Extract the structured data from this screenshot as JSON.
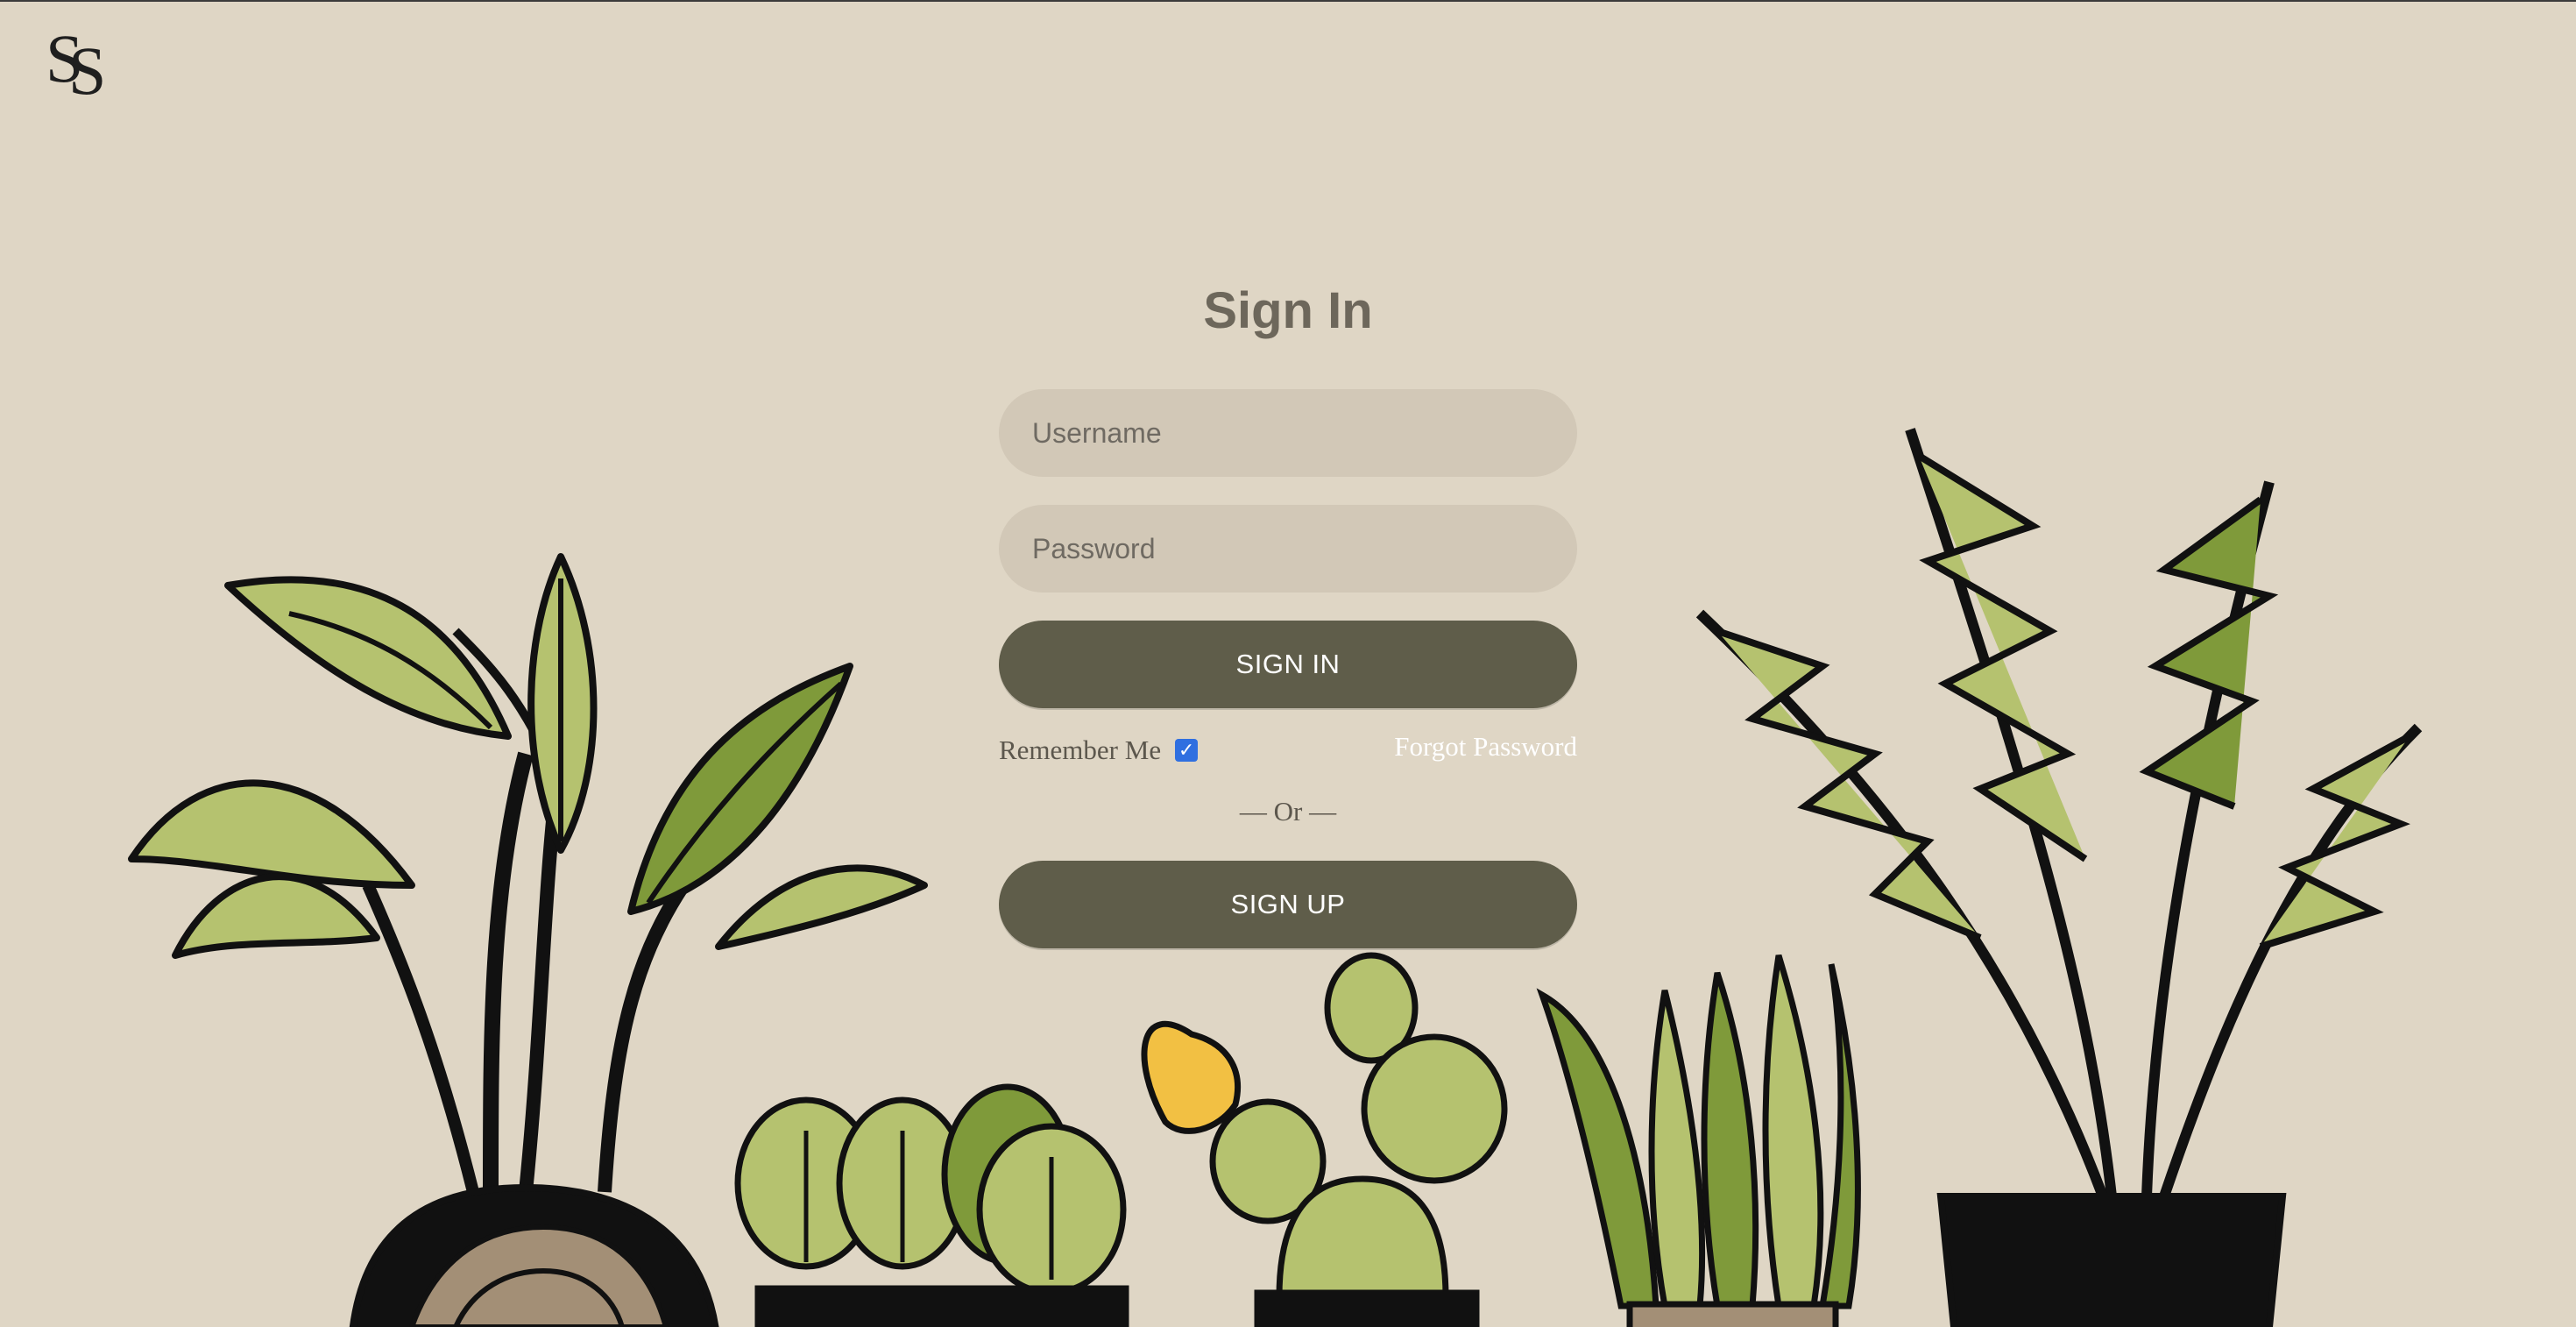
{
  "logo": {
    "letter1": "S",
    "letter2": "S"
  },
  "signin": {
    "title": "Sign In",
    "username_placeholder": "Username",
    "password_placeholder": "Password",
    "signin_label": "SIGN IN",
    "remember_label": "Remember Me",
    "remember_checked": true,
    "forgot_label": "Forgot Password",
    "or_label": "— Or —",
    "signup_label": "SIGN UP"
  },
  "colors": {
    "background": "#dfd6c5",
    "input_bg": "#d2c8b7",
    "button_bg": "#5f5d4a",
    "title": "#6d675b",
    "leaf_light": "#b5c26f",
    "leaf_dark": "#7f9a3a",
    "pot": "#111111",
    "accent_flower": "#f2c043"
  },
  "illustration": {
    "icons": [
      "large-leaf-plant-icon",
      "round-leaf-plant-icon",
      "cactus-icon",
      "aloe-plant-icon",
      "fern-plant-icon"
    ]
  }
}
